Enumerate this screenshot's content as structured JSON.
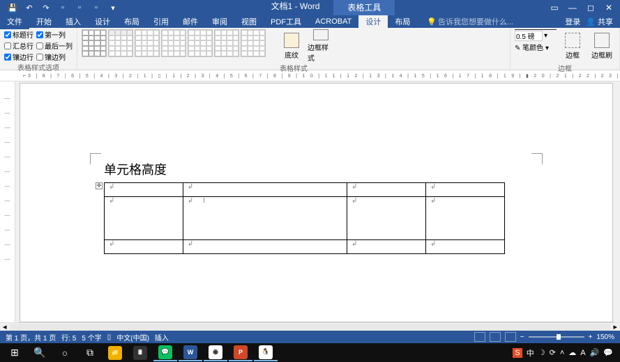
{
  "title_bar": {
    "doc_title": "文档1 - Word",
    "contextual_tab": "表格工具"
  },
  "menu": {
    "tabs": [
      "文件",
      "开始",
      "插入",
      "设计",
      "布局",
      "引用",
      "邮件",
      "审阅",
      "视图",
      "PDF工具",
      "ACROBAT",
      "设计",
      "布局"
    ],
    "active_index": 11,
    "tell_me": "告诉我您想要做什么...",
    "login": "登录",
    "share": "共享"
  },
  "ribbon": {
    "options": {
      "header_row": "标题行",
      "first_col": "第一列",
      "total_row": "汇总行",
      "last_col": "最后一列",
      "banded_row": "镶边行",
      "banded_col": "镶边列",
      "group_label": "表格样式选项"
    },
    "styles_group": "表格样式",
    "shading": "底纹",
    "border_style": "边框样式",
    "border_width_value": "0.5 磅",
    "pen_color": "笔颜色",
    "borders_group": "边框",
    "borders_btn": "边框",
    "border_painter": "边框刷"
  },
  "document": {
    "heading": "单元格高度"
  },
  "status": {
    "page": "第 1 页，共 1 页",
    "line": "行: 5",
    "words": "5 个字",
    "lang_icon": "",
    "lang": "中文(中国)",
    "mode": "插入",
    "zoom": "150%"
  },
  "taskbar": {
    "time": ""
  }
}
